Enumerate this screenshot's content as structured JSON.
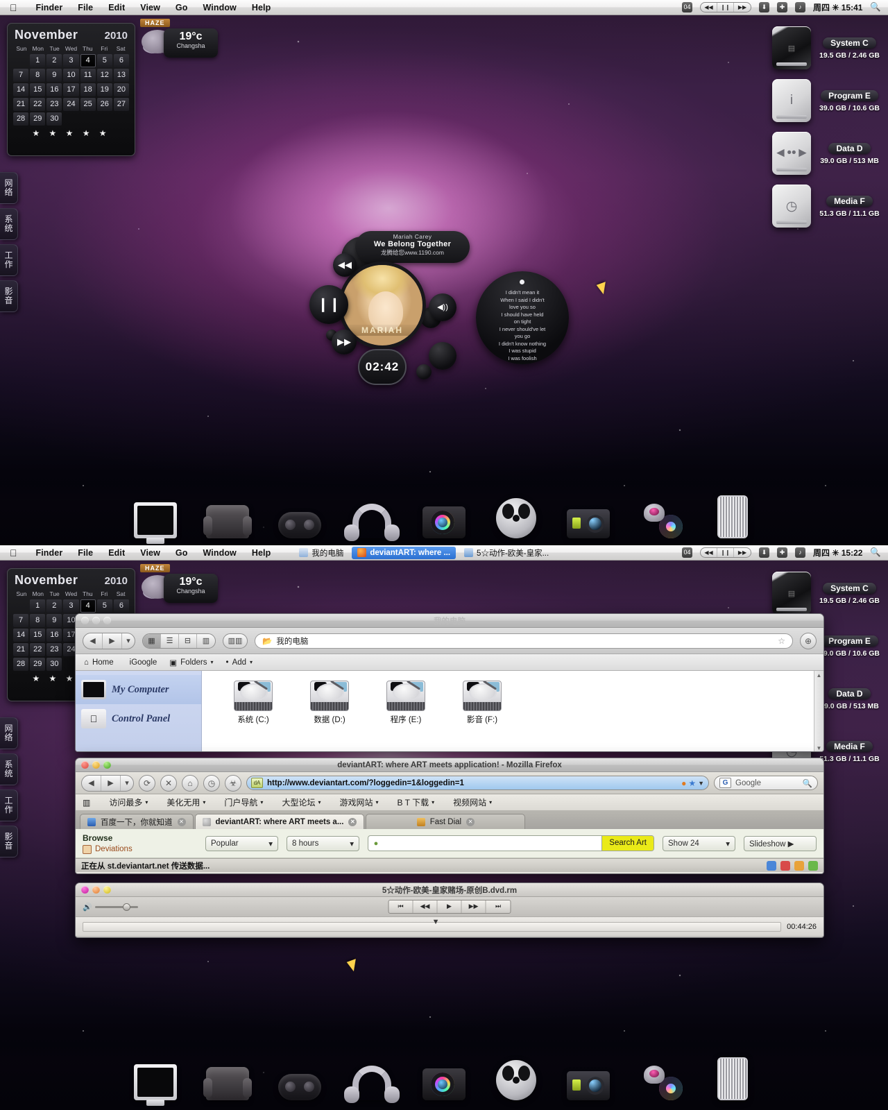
{
  "menubar": {
    "apple_icon": "apple-icon",
    "items": [
      "Finder",
      "File",
      "Edit",
      "View",
      "Go",
      "Window",
      "Help"
    ],
    "right": {
      "itunes_prev": "◀◀",
      "itunes_play": "❙❙",
      "itunes_next": "▶▶",
      "badge": "04",
      "icon_download": "⬇",
      "icon_add": "✚",
      "icon_note": "♪",
      "clock_top": "周四 ✳ 15:41",
      "clock_bottom": "周四 ✳ 15:22",
      "search_icon": "search-icon"
    }
  },
  "taskbar": {
    "items": [
      {
        "label": "我的电脑",
        "icon": "computer-icon",
        "active": false
      },
      {
        "label": "deviantART: where ...",
        "icon": "firefox-icon",
        "active": true
      },
      {
        "label": "5☆动作-欧美-皇家...",
        "icon": "realplayer-icon",
        "active": false
      }
    ]
  },
  "calendar": {
    "month": "November",
    "year": "2010",
    "dow": [
      "Sun",
      "Mon",
      "Tue",
      "Wed",
      "Thu",
      "Fri",
      "Sat"
    ],
    "lead_blanks": 1,
    "days": [
      1,
      2,
      3,
      4,
      5,
      6,
      7,
      8,
      9,
      10,
      11,
      12,
      13,
      14,
      15,
      16,
      17,
      18,
      19,
      20,
      21,
      22,
      23,
      24,
      25,
      26,
      27,
      28,
      29,
      30
    ],
    "today": 4,
    "stars": "★ ★ ★ ★ ★"
  },
  "weather": {
    "condition": "HAZE",
    "temp": "19°c",
    "city": "Changsha",
    "cloud_icon": "cloud-icon"
  },
  "edge_tabs": [
    "网络",
    "系统",
    "工作",
    "影音"
  ],
  "drives": [
    {
      "name": "System C",
      "size": "19.5 GB / 2.46 GB",
      "icon": "hdd-dark-icon",
      "glyph": "▤"
    },
    {
      "name": "Program E",
      "size": "39.0 GB / 10.6 GB",
      "icon": "hdd-info-icon",
      "glyph": "i"
    },
    {
      "name": "Data D",
      "size": "39.0 GB / 513 MB",
      "icon": "hdd-data-icon",
      "glyph": "◄••►"
    },
    {
      "name": "Media F",
      "size": "51.3 GB / 11.1 GB",
      "icon": "hdd-clock-icon",
      "glyph": "◷"
    }
  ],
  "player": {
    "artist": "Mariah Carey",
    "title": "We Belong Together",
    "site": "龙腾给您www.1190.com",
    "elapsed": "02:42",
    "album_text": "MARIAH",
    "buttons": {
      "prev": "◀◀",
      "play_pause": "❙❙",
      "next": "▶▶",
      "volume": "◀))"
    },
    "lyrics": [
      "I didn't mean it",
      "When I said I didn't",
      "love you so",
      "I should have held",
      "on tight",
      "I never should've let",
      "you go",
      "I didn't know nothing",
      "I was stupid",
      "I was foolish"
    ]
  },
  "dock": [
    {
      "name": "monitor-icon",
      "label": "Monitor"
    },
    {
      "name": "armchair-icon",
      "label": "Armchair"
    },
    {
      "name": "gamepad-icon",
      "label": "Gamepad"
    },
    {
      "name": "headphones-icon",
      "label": "Headphones"
    },
    {
      "name": "camera-icon",
      "label": "Camera"
    },
    {
      "name": "film-reel-icon",
      "label": "Film Reel"
    },
    {
      "name": "camcorder-icon",
      "label": "Camcorder"
    },
    {
      "name": "robot-disc-icon",
      "label": "Robot Disc"
    },
    {
      "name": "trash-icon",
      "label": "Trash"
    }
  ],
  "explorer": {
    "title": "我的电脑",
    "address": "我的电脑",
    "view_modes": [
      "▦",
      "☰",
      "⊟",
      "▥"
    ],
    "extra_view": "▥▥",
    "nav_back": "◀",
    "nav_fwd": "▶",
    "nav_drop": "▾",
    "action_button": "⊕",
    "star": "☆",
    "bookmarks": [
      {
        "label": "Home",
        "icon": "home-icon"
      },
      {
        "label": "iGoogle",
        "icon": "igoogle-icon"
      },
      {
        "label": "Folders",
        "icon": "folders-icon",
        "caret": "▾"
      },
      {
        "label": "Add",
        "icon": "add-icon",
        "caret": "▾"
      }
    ],
    "sidebar": [
      {
        "label": "My Computer",
        "icon": "computer-icon",
        "selected": true
      },
      {
        "label": "Control Panel",
        "icon": "control-panel-icon",
        "selected": false
      }
    ],
    "files": [
      {
        "label": "系统 (C:)",
        "icon": "hdd-icon"
      },
      {
        "label": "数据 (D:)",
        "icon": "hdd-icon"
      },
      {
        "label": "程序 (E:)",
        "icon": "hdd-icon"
      },
      {
        "label": "影音 (F:)",
        "icon": "hdd-icon"
      }
    ]
  },
  "firefox": {
    "title": "deviantART: where ART meets application! - Mozilla Firefox",
    "url": "http://www.deviantart.com/?loggedin=1&loggedin=1",
    "search_engine": "Google",
    "search_placeholder": "Google",
    "toolbar_icons": {
      "back": "◀",
      "forward": "▶",
      "drop": "▾",
      "reload": "⟳",
      "stop": "✕",
      "home": "⌂",
      "history": "◷",
      "bug": "☣"
    },
    "url_end_icons": [
      "rss-icon",
      "star-icon",
      "caret-down-icon"
    ],
    "bookmarks": [
      "访问最多",
      "美化无用",
      "门户导航",
      "大型论坛",
      "游戏网站",
      "B T 下载",
      "视频网站"
    ],
    "bookmarks_first_icon": "grid-icon",
    "tabs": [
      {
        "label": "百度一下，你就知道",
        "active": false
      },
      {
        "label": "deviantART: where ART meets a...",
        "active": true
      },
      {
        "label": "Fast Dial",
        "active": false
      }
    ],
    "page": {
      "browse_heading": "Browse",
      "browse_sub": "Deviations",
      "filter_sort": "Popular",
      "filter_time": "8 hours",
      "search_value": "",
      "search_button": "Search Art",
      "show_count": "Show 24",
      "slideshow": "Slideshow ▶"
    },
    "status": "正在从 st.deviantart.net 传送数据..."
  },
  "media_player": {
    "title": "5☆动作-欧美-皇家赌场-原创B.dvd.rm",
    "transport": [
      "⏮",
      "◀◀",
      "▶",
      "▶▶",
      "⏭"
    ],
    "duration": "00:44:26",
    "volume_icon": "volume-icon"
  },
  "colors": {
    "accent_pink": "#d64bb0",
    "haze": "#b5792f",
    "search_button": "#eaea18",
    "selection_blue": "#b2c4e8"
  }
}
